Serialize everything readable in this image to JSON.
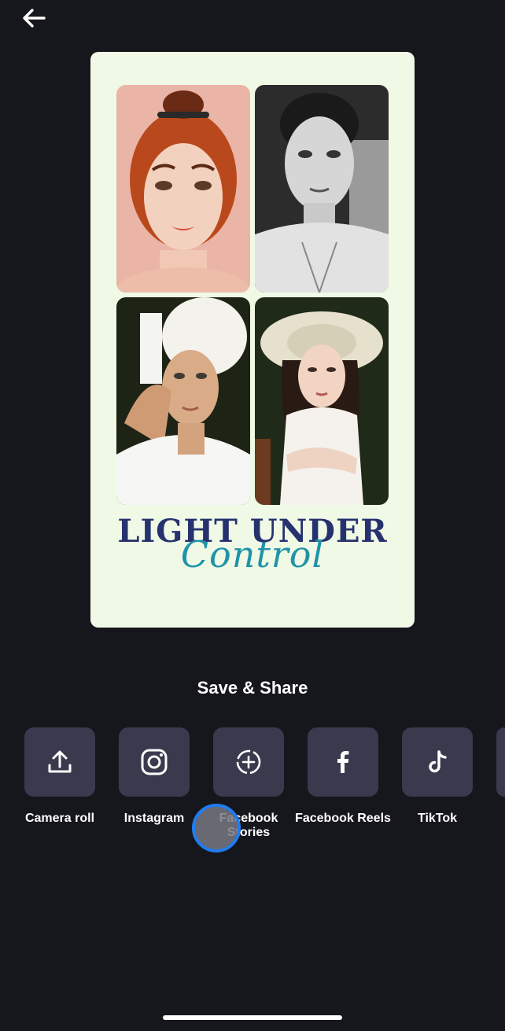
{
  "preview": {
    "headline": "LIGHT UNDER",
    "script_word": "Control"
  },
  "share": {
    "title": "Save & Share",
    "options": [
      {
        "label": "Camera roll",
        "icon": "upload-icon"
      },
      {
        "label": "Instagram",
        "icon": "instagram-icon"
      },
      {
        "label": "Facebook Stories",
        "icon": "facebook-stories-icon"
      },
      {
        "label": "Facebook Reels",
        "icon": "facebook-icon"
      },
      {
        "label": "TikTok",
        "icon": "tiktok-icon"
      }
    ]
  },
  "colors": {
    "background": "#16161d",
    "tile": "#3a3a4e",
    "card": "#f0f9e6",
    "headline": "#26326e",
    "script": "#1f93a8",
    "touch_ring": "#1e7df0"
  }
}
